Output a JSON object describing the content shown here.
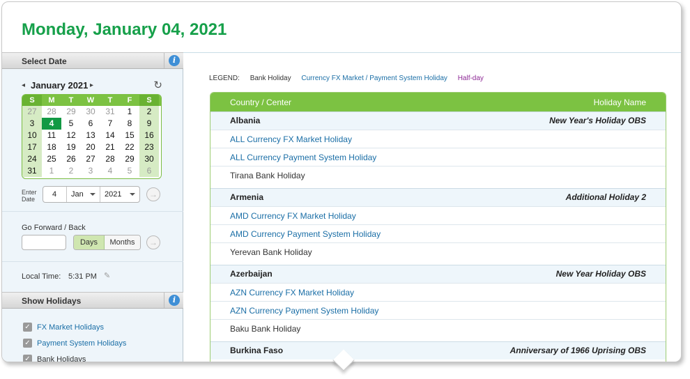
{
  "page_title": "Monday, January 04, 2021",
  "colors": {
    "brand_green": "#16a04a",
    "header_green": "#7cc242",
    "link_blue": "#1a6ea6",
    "half_day_purple": "#8e2a96"
  },
  "sidebar": {
    "select_date": {
      "heading": "Select Date",
      "info_icon": "i",
      "calendar": {
        "month_label": "January 2021",
        "prev_icon": "◂",
        "next_icon": "▸",
        "reset_icon": "↻",
        "weekdays": [
          "S",
          "M",
          "T",
          "W",
          "T",
          "F",
          "S"
        ],
        "weeks": [
          [
            "27",
            "28",
            "29",
            "30",
            "31",
            "1",
            "2"
          ],
          [
            "3",
            "4",
            "5",
            "6",
            "7",
            "8",
            "9"
          ],
          [
            "10",
            "11",
            "12",
            "13",
            "14",
            "15",
            "16"
          ],
          [
            "17",
            "18",
            "19",
            "20",
            "21",
            "22",
            "23"
          ],
          [
            "24",
            "25",
            "26",
            "27",
            "28",
            "29",
            "30"
          ],
          [
            "31",
            "1",
            "2",
            "3",
            "4",
            "5",
            "6"
          ]
        ],
        "selected_day": "4"
      },
      "enter_date_label": "Enter Date",
      "day_value": "4",
      "month_value": "Jan",
      "year_value": "2021",
      "go_icon": "→"
    },
    "forward_back": {
      "label": "Go Forward / Back",
      "input_value": "",
      "days_label": "Days",
      "months_label": "Months",
      "go_icon": "→"
    },
    "local_time": {
      "label": "Local Time:",
      "value": "5:31 PM",
      "edit_icon": "✎"
    },
    "show_holidays": {
      "heading": "Show Holidays",
      "info_icon": "i",
      "options": [
        {
          "label": "FX Market Holidays",
          "checked": true
        },
        {
          "label": "Payment System Holidays",
          "checked": true
        },
        {
          "label": "Bank Holidays",
          "checked": true
        }
      ]
    }
  },
  "legend": {
    "label": "LEGEND:",
    "bank": "Bank Holiday",
    "fx": "Currency FX Market / Payment System Holiday",
    "half": "Half-day"
  },
  "table": {
    "col_country": "Country / Center",
    "col_holiday": "Holiday Name",
    "groups": [
      {
        "country": "Albania",
        "holiday": "New Year's Holiday OBS",
        "rows": [
          {
            "text": "ALL Currency FX Market Holiday",
            "type": "fx"
          },
          {
            "text": "ALL Currency Payment System Holiday",
            "type": "fx"
          },
          {
            "text": "Tirana Bank Holiday",
            "type": "bank"
          }
        ]
      },
      {
        "country": "Armenia",
        "holiday": "Additional Holiday 2",
        "rows": [
          {
            "text": "AMD Currency FX Market Holiday",
            "type": "fx"
          },
          {
            "text": "AMD Currency Payment System Holiday",
            "type": "fx"
          },
          {
            "text": "Yerevan Bank Holiday",
            "type": "bank"
          }
        ]
      },
      {
        "country": "Azerbaijan",
        "holiday": "New Year Holiday OBS",
        "rows": [
          {
            "text": "AZN Currency FX Market Holiday",
            "type": "fx"
          },
          {
            "text": "AZN Currency Payment System Holiday",
            "type": "fx"
          },
          {
            "text": "Baku Bank Holiday",
            "type": "bank"
          }
        ]
      },
      {
        "country": "Burkina Faso",
        "holiday": "Anniversary of 1966 Uprising OBS",
        "rows": []
      }
    ]
  }
}
